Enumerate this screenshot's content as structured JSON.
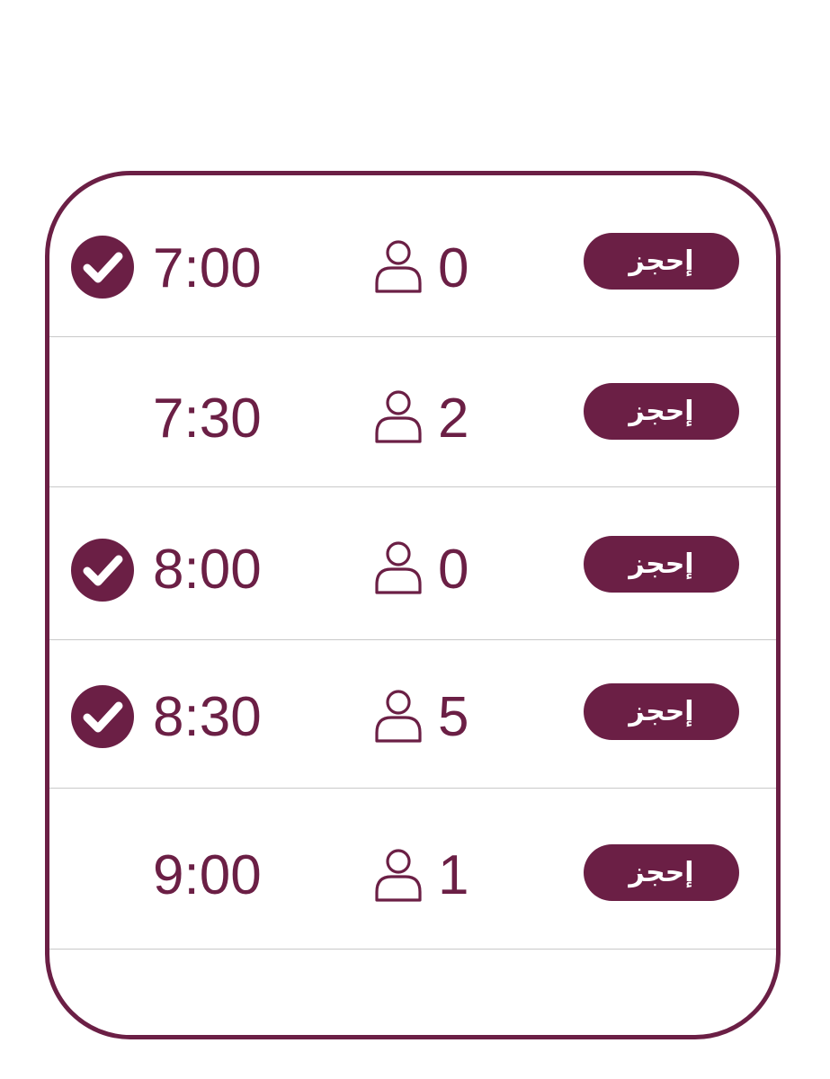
{
  "slots": [
    {
      "time": "7:00",
      "count": "0",
      "checked": true,
      "book_label": "إحجز"
    },
    {
      "time": "7:30",
      "count": "2",
      "checked": false,
      "book_label": "إحجز"
    },
    {
      "time": "8:00",
      "count": "0",
      "checked": true,
      "book_label": "إحجز"
    },
    {
      "time": "8:30",
      "count": "5",
      "checked": true,
      "book_label": "إحجز"
    },
    {
      "time": "9:00",
      "count": "1",
      "checked": false,
      "book_label": "إحجز"
    }
  ],
  "icons": {
    "selected": "check-circle-icon",
    "attendees": "person-outline-icon"
  },
  "colors": {
    "accent": "#6b1f45",
    "divider": "#c9c9c9",
    "background": "#ffffff"
  }
}
